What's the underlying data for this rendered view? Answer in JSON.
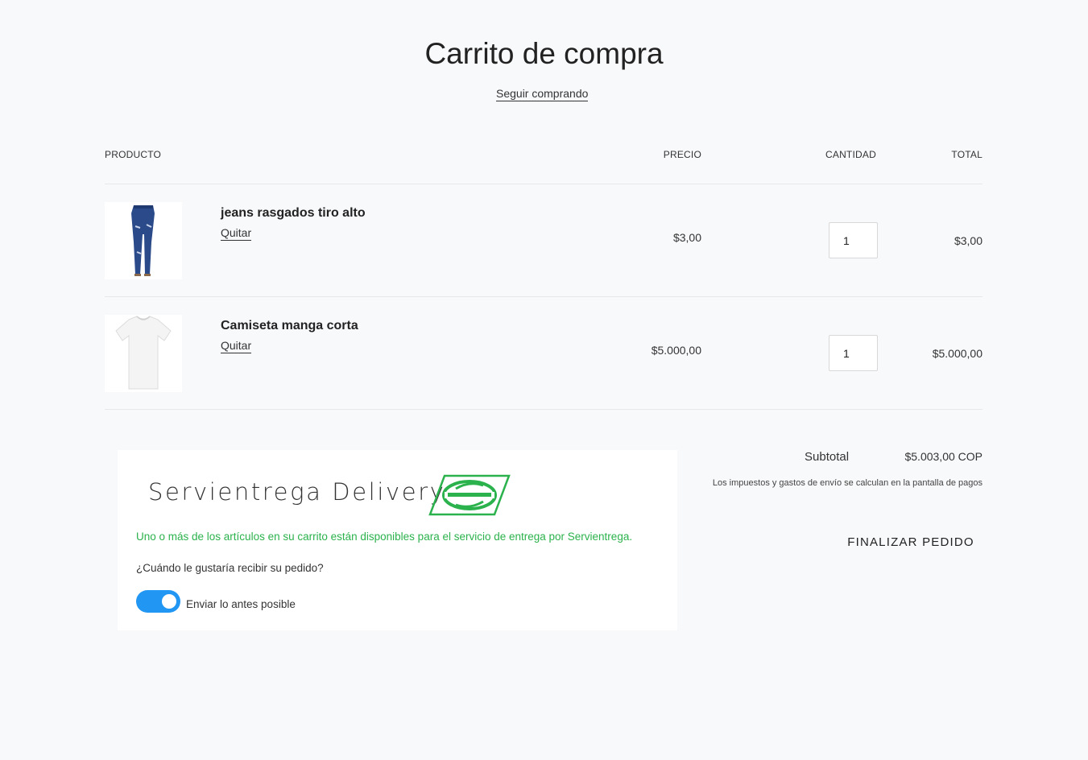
{
  "page": {
    "title": "Carrito de compra",
    "continue_link": "Seguir comprando"
  },
  "table": {
    "headers": {
      "product": "PRODUCTO",
      "price": "PRECIO",
      "quantity": "CANTIDAD",
      "total": "TOTAL"
    },
    "items": [
      {
        "name": "jeans rasgados tiro alto",
        "remove_label": "Quitar",
        "price": "$3,00",
        "quantity": "1",
        "total": "$3,00",
        "image_icon": "jeans-image"
      },
      {
        "name": "Camiseta manga corta",
        "remove_label": "Quitar",
        "price": "$5.000,00",
        "quantity": "1",
        "total": "$5.000,00",
        "image_icon": "tshirt-image"
      }
    ]
  },
  "summary": {
    "subtotal_label": "Subtotal",
    "subtotal_value": "$5.003,00 COP",
    "tax_note": "Los impuestos y gastos de envío se calculan en la pantalla de pagos",
    "checkout_label": "FINALIZAR PEDIDO"
  },
  "delivery": {
    "brand": "Servientrega Delivery",
    "availability_message": "Uno o más de los artículos en su carrito están disponibles para el servicio de entrega por Servientrega.",
    "question": "¿Cuándo le gustaría recibir su pedido?",
    "toggle_label": "Enviar lo antes posible",
    "toggle_on": true,
    "brand_color": "#2bb24c",
    "toggle_color": "#2196f3"
  }
}
